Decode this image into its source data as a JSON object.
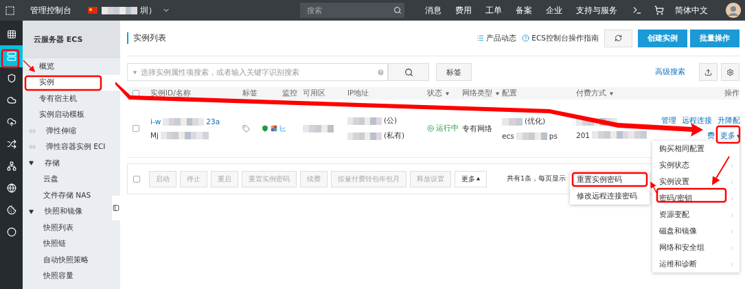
{
  "top_bar": {
    "title": "管理控制台",
    "region": "圳）",
    "search": {
      "placeholder": "搜索"
    },
    "nav": [
      "消息",
      "费用",
      "工单",
      "备案",
      "企业",
      "支持与服务"
    ],
    "language": "简体中文"
  },
  "rail": [
    {
      "selected": false
    },
    {
      "selected": true
    },
    {
      "selected": false
    },
    {
      "selected": false
    },
    {
      "selected": false
    },
    {
      "selected": false
    },
    {
      "selected": false
    },
    {
      "selected": false
    },
    {
      "selected": false
    },
    {
      "selected": false
    }
  ],
  "sidebar": {
    "title": "云服务器 ECS",
    "items": [
      {
        "kind": "plain",
        "label": "概览",
        "selected": false
      },
      {
        "kind": "plain",
        "label": "实例",
        "selected": true
      },
      {
        "kind": "plain",
        "label": "专有宿主机",
        "selected": false
      },
      {
        "kind": "plain",
        "label": "实例启动模板",
        "selected": false
      },
      {
        "kind": "link",
        "label": "弹性伸缩",
        "selected": false
      },
      {
        "kind": "link",
        "label": "弹性容器实例 ECI",
        "selected": false
      },
      {
        "kind": "group",
        "label": "存储",
        "expanded": true,
        "children": [
          {
            "label": "云盘",
            "selected": false
          },
          {
            "label": "文件存储 NAS",
            "selected": false
          }
        ]
      },
      {
        "kind": "group",
        "label": "快照和镜像",
        "expanded": true,
        "children": [
          {
            "label": "快照列表",
            "selected": false
          },
          {
            "label": "快照链",
            "selected": false
          },
          {
            "label": "自动快照策略",
            "selected": false
          },
          {
            "label": "快照容量",
            "selected": false
          }
        ]
      }
    ]
  },
  "page": {
    "title": "实例列表",
    "links": [
      "产品动态",
      "ECS控制台操作指南"
    ],
    "buttons": [
      "创建实例",
      "批量操作"
    ]
  },
  "search": {
    "placeholder": "选择实例属性项搜索，或者输入关键字识别搜索",
    "tag_button": "标签",
    "advanced": "高级搜索"
  },
  "table": {
    "select_all": {
      "checked": false
    },
    "columns": [
      {
        "label": "实例ID/名称",
        "sortable": false
      },
      {
        "label": "标签",
        "sortable": false
      },
      {
        "label": "监控",
        "sortable": false
      },
      {
        "label": "可用区",
        "sortable": false
      },
      {
        "label": "IP地址",
        "sortable": false
      },
      {
        "label": "状态",
        "sortable": true
      },
      {
        "label": "网络类型",
        "sortable": true
      },
      {
        "label": "配置",
        "sortable": false
      },
      {
        "label": "付费方式",
        "sortable": true
      },
      {
        "label": "操作",
        "sortable": false
      }
    ],
    "rows": [
      {
        "checked": false,
        "instance_id": [
          "i-w",
          "23a"
        ],
        "name": "Mj",
        "ip": [
          "(公)",
          "(私有)"
        ],
        "status": {
          "kind": "running",
          "label": "运行中"
        },
        "network": "专有网络",
        "config": [
          "(优化)",
          "ecs",
          "ps"
        ],
        "payment": "201",
        "actions": [
          "管理",
          "远程连接",
          "升降配",
          "费",
          "更多"
        ]
      }
    ]
  },
  "bulk": {
    "checked": false,
    "buttons": [
      {
        "label": "启动",
        "disabled": true
      },
      {
        "label": "停止",
        "disabled": true
      },
      {
        "label": "重启",
        "disabled": true
      },
      {
        "label": "重置实例密码",
        "disabled": true
      },
      {
        "label": "续费",
        "disabled": true
      },
      {
        "label": "按量付费转包年包月",
        "disabled": true
      },
      {
        "label": "释放设置",
        "disabled": true
      },
      {
        "label": "更多",
        "disabled": false
      }
    ],
    "pagination": "共有1条，每页显示"
  },
  "menu": {
    "items": [
      {
        "label": "购买相同配置",
        "submenu": false
      },
      {
        "label": "实例状态",
        "submenu": true
      },
      {
        "label": "实例设置",
        "submenu": true
      },
      {
        "label": "密码/密钥",
        "submenu": true
      },
      {
        "label": "资源变配",
        "submenu": true
      },
      {
        "label": "磁盘和镜像",
        "submenu": true
      },
      {
        "label": "网络和安全组",
        "submenu": true
      },
      {
        "label": "运维和诊断",
        "submenu": true
      }
    ]
  },
  "submenu": {
    "items": [
      "重置实例密码",
      "修改远程连接密码"
    ]
  }
}
